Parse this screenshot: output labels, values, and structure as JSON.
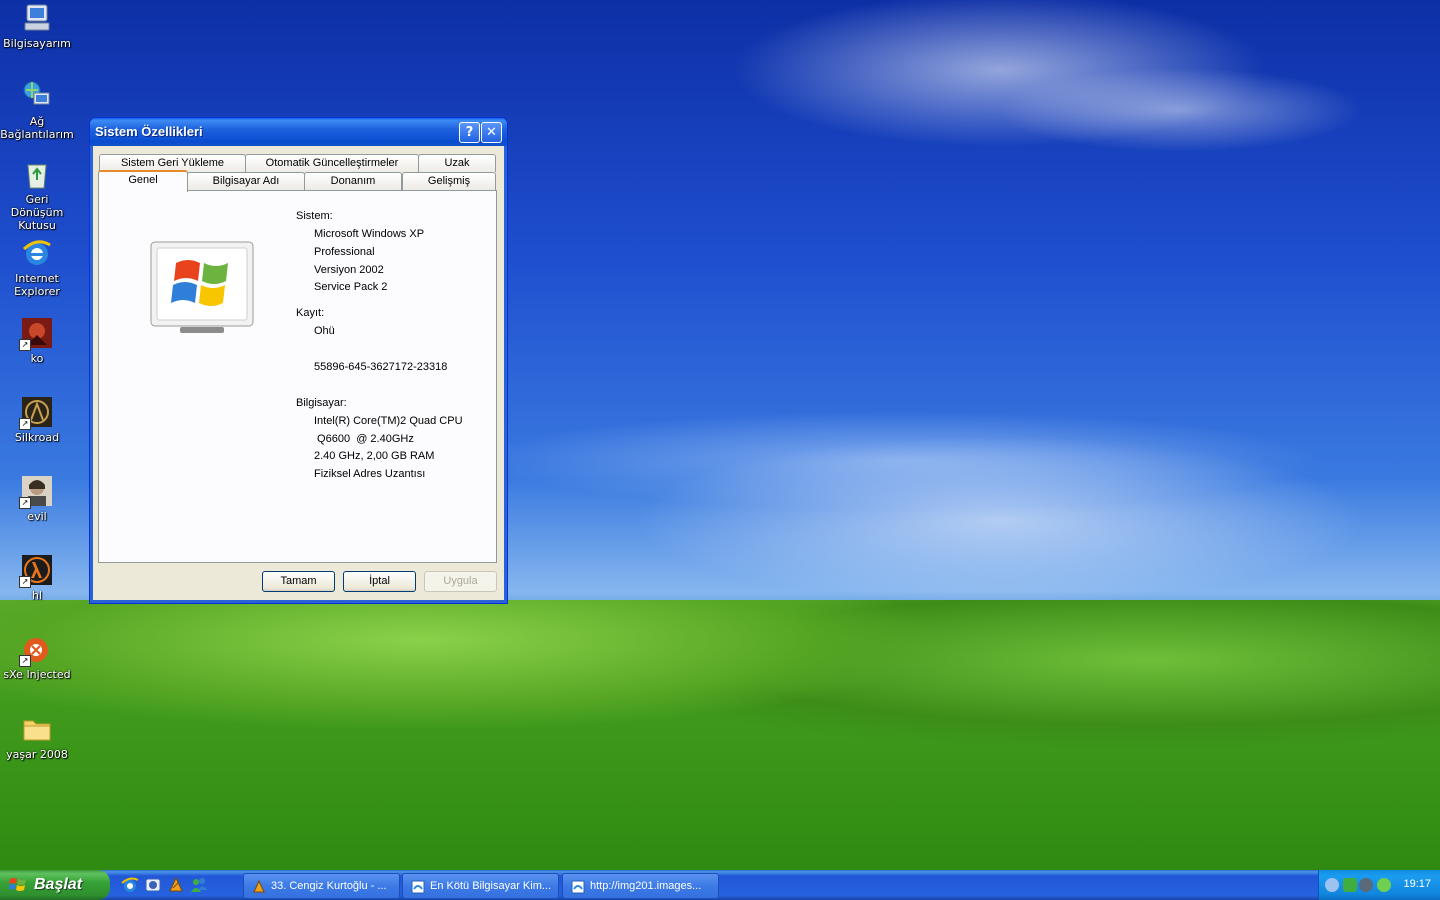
{
  "desktop": {
    "icons": [
      {
        "label": "Bilgisayarım"
      },
      {
        "label": "Ağ Bağlantılarım"
      },
      {
        "label": "Geri Dönüşüm Kutusu"
      },
      {
        "label": "Internet Explorer"
      },
      {
        "label": "ko"
      },
      {
        "label": "Silkroad"
      },
      {
        "label": "evil"
      },
      {
        "label": "hl"
      },
      {
        "label": "sXe Injected"
      },
      {
        "label": "yaşar 2008"
      }
    ]
  },
  "window": {
    "title": "Sistem Özellikleri",
    "help_label": "?",
    "close_label": "✕",
    "tabs_row1": [
      "Sistem Geri Yükleme",
      "Otomatik Güncelleştirmeler",
      "Uzak"
    ],
    "tabs_row2": [
      "Genel",
      "Bilgisayar Adı",
      "Donanım",
      "Gelişmiş"
    ],
    "active_tab": "Genel",
    "system": {
      "heading": "Sistem:",
      "lines": [
        "Microsoft Windows XP",
        "Professional",
        "Versiyon 2002",
        "Service Pack 2"
      ]
    },
    "registration": {
      "heading": "Kayıt:",
      "name": "Ohü",
      "product_id": "55896-645-3627172-23318"
    },
    "computer": {
      "heading": "Bilgisayar:",
      "lines": [
        "Intel(R) Core(TM)2 Quad CPU",
        " Q6600  @ 2.40GHz",
        "2.40 GHz, 2,00 GB RAM",
        "Fiziksel Adres Uzantısı"
      ]
    },
    "buttons": {
      "ok": "Tamam",
      "cancel": "İptal",
      "apply": "Uygula"
    }
  },
  "taskbar": {
    "start_label": "Başlat",
    "tasks": [
      {
        "label": "33. Cengiz Kurtoğlu - ..."
      },
      {
        "label": "En Kötü Bilgisayar Kim..."
      },
      {
        "label": "http://img201.images..."
      }
    ],
    "clock": "19:17"
  }
}
